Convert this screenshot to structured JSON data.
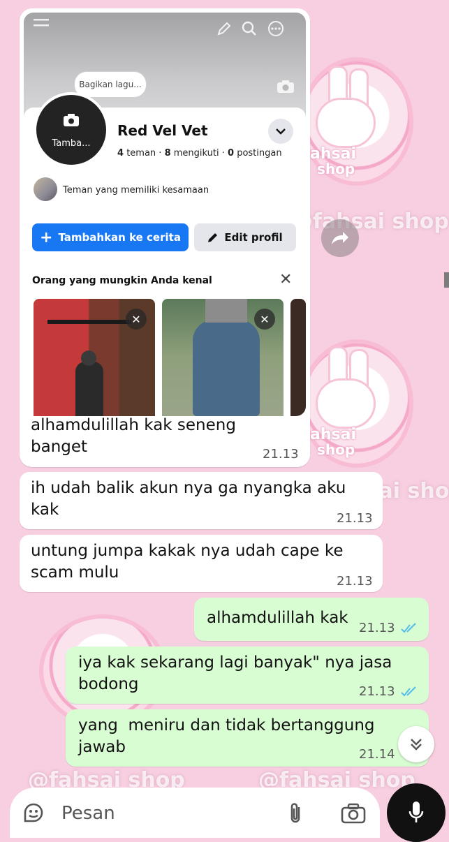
{
  "background": {
    "watermark": "@fahsai shop",
    "shop_label": "ahsai",
    "shop_sub": "shop"
  },
  "profile_shot": {
    "share_song": "Bagikan lagu...",
    "avatar_label": "Tamba...",
    "name": "Red Vel Vet",
    "friends_count": "4",
    "friends_label": "teman",
    "following_count": "8",
    "following_label": "mengikuti",
    "posts_count": "0",
    "posts_label": "postingan",
    "mutual_text": "Teman yang memiliki kesamaan",
    "add_story": "Tambahkan ke cerita",
    "edit_profile": "Edit profil",
    "pymk_title": "Orang yang mungkin Anda kenal"
  },
  "messages": [
    {
      "dir": "in",
      "text": "alhamdulillah kak seneng banget",
      "time": "21.13"
    },
    {
      "dir": "in",
      "text": "ih udah balik akun nya ga nyangka aku kak",
      "time": "21.13"
    },
    {
      "dir": "in",
      "text": "untung jumpa kakak nya udah cape ke scam mulu",
      "time": "21.13"
    },
    {
      "dir": "out",
      "text": "alhamdulillah kak",
      "time": "21.13",
      "status": "read"
    },
    {
      "dir": "out",
      "text": "iya kak sekarang lagi banyak\" nya jasa bodong",
      "time": "21.13",
      "status": "read"
    },
    {
      "dir": "out",
      "text": "yang  meniru dan tidak bertanggung jawab",
      "time": "21.14",
      "status": "read"
    }
  ],
  "input": {
    "placeholder": "Pesan"
  },
  "colors": {
    "incoming": "#ffffff",
    "outgoing": "#d9fdd3",
    "tick_read": "#53bdeb",
    "fb_blue": "#1877f2",
    "bg": "#f7cfe0"
  },
  "icons": [
    "menu-icon",
    "pencil-icon",
    "search-icon",
    "more-icon",
    "camera-icon",
    "chevron-down-icon",
    "plus-icon",
    "edit-pen-icon",
    "close-icon",
    "forward-icon",
    "double-chevron-down-icon",
    "sticker-icon",
    "attach-icon",
    "camera-icon",
    "mic-icon"
  ]
}
